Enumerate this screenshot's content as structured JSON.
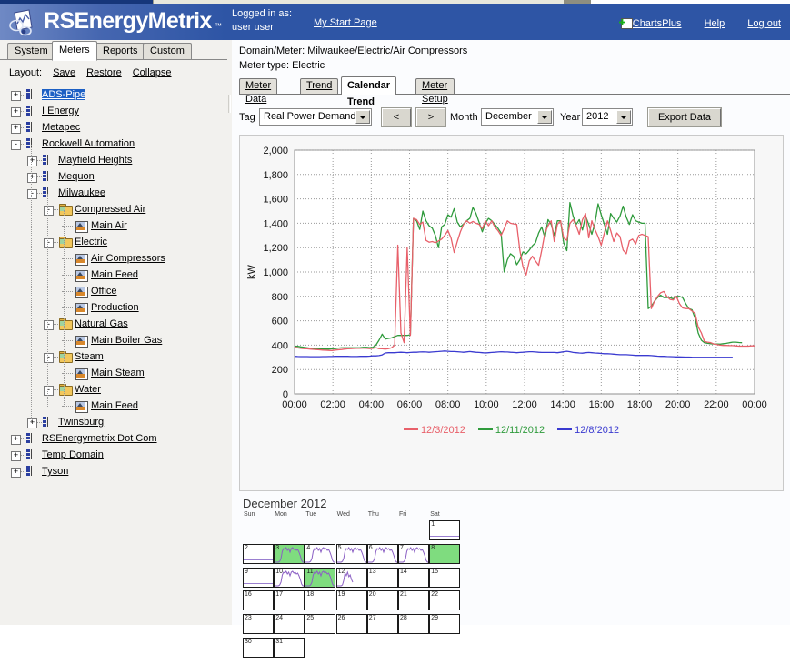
{
  "app": {
    "brand_rs": "RS",
    "brand_rest": "EnergyMetrix",
    "brand_tm": "™",
    "logged_in_label": "Logged in as:",
    "user": "user user",
    "my_start_page": "My Start Page",
    "header_color": "#2e55a5"
  },
  "header_links": [
    {
      "label": "ChartsPlus",
      "icon": "charts-plus-icon"
    },
    {
      "label": "Help",
      "icon": ""
    },
    {
      "label": "Log out",
      "icon": ""
    }
  ],
  "main_tabs": [
    {
      "label": "System",
      "active": false
    },
    {
      "label": "Meters",
      "active": true
    },
    {
      "label": "Reports",
      "active": false
    },
    {
      "label": "Custom",
      "active": false
    }
  ],
  "layout_bar": {
    "label": "Layout:",
    "actions": [
      "Save",
      "Restore",
      "Collapse"
    ]
  },
  "tree": [
    {
      "label": "ADS-Pipe",
      "depth": 0,
      "toggle": "+",
      "icon": "domain-icon",
      "selected": true
    },
    {
      "label": "I Energy",
      "depth": 0,
      "toggle": "+",
      "icon": "domain-icon",
      "selected": false
    },
    {
      "label": "Metapec",
      "depth": 0,
      "toggle": "+",
      "icon": "domain-icon",
      "selected": false
    },
    {
      "label": "Rockwell Automation",
      "depth": 0,
      "toggle": "-",
      "icon": "domain-icon",
      "selected": false
    },
    {
      "label": "Mayfield Heights",
      "depth": 1,
      "toggle": "+",
      "icon": "domain-icon",
      "selected": false
    },
    {
      "label": "Mequon",
      "depth": 1,
      "toggle": "+",
      "icon": "domain-icon",
      "selected": false
    },
    {
      "label": "Milwaukee",
      "depth": 1,
      "toggle": "-",
      "icon": "domain-icon",
      "selected": false
    },
    {
      "label": "Compressed Air",
      "depth": 2,
      "toggle": "-",
      "icon": "folder-icon",
      "selected": false
    },
    {
      "label": "Main Air",
      "depth": 3,
      "toggle": "",
      "icon": "meter-icon",
      "selected": false
    },
    {
      "label": "Electric",
      "depth": 2,
      "toggle": "-",
      "icon": "folder-icon",
      "selected": false
    },
    {
      "label": "Air Compressors",
      "depth": 3,
      "toggle": "",
      "icon": "meter-icon",
      "selected": false
    },
    {
      "label": "Main Feed",
      "depth": 3,
      "toggle": "",
      "icon": "meter-icon",
      "selected": false
    },
    {
      "label": "Office",
      "depth": 3,
      "toggle": "",
      "icon": "meter-icon",
      "selected": false
    },
    {
      "label": "Production",
      "depth": 3,
      "toggle": "",
      "icon": "meter-icon",
      "selected": false
    },
    {
      "label": "Natural Gas",
      "depth": 2,
      "toggle": "-",
      "icon": "folder-icon",
      "selected": false
    },
    {
      "label": "Main Boiler Gas",
      "depth": 3,
      "toggle": "",
      "icon": "meter-icon",
      "selected": false
    },
    {
      "label": "Steam",
      "depth": 2,
      "toggle": "-",
      "icon": "folder-icon",
      "selected": false
    },
    {
      "label": "Main Steam",
      "depth": 3,
      "toggle": "",
      "icon": "meter-icon",
      "selected": false
    },
    {
      "label": "Water",
      "depth": 2,
      "toggle": "-",
      "icon": "folder-icon",
      "selected": false
    },
    {
      "label": "Main Feed",
      "depth": 3,
      "toggle": "",
      "icon": "meter-icon",
      "selected": false
    },
    {
      "label": "Twinsburg",
      "depth": 1,
      "toggle": "+",
      "icon": "domain-icon",
      "selected": false
    },
    {
      "label": "RSEnergymetrix Dot Com",
      "depth": 0,
      "toggle": "+",
      "icon": "domain-icon",
      "selected": false
    },
    {
      "label": "Temp Domain",
      "depth": 0,
      "toggle": "+",
      "icon": "domain-icon",
      "selected": false
    },
    {
      "label": "Tyson",
      "depth": 0,
      "toggle": "+",
      "icon": "domain-icon",
      "selected": false
    }
  ],
  "breadcrumb": {
    "domain_meter": "Domain/Meter: Milwaukee/Electric/Air Compressors",
    "meter_type": "Meter type: Electric"
  },
  "sub_tabs": [
    {
      "label": "Meter Data",
      "active": false
    },
    {
      "label": "Trend",
      "active": false
    },
    {
      "label": "Calendar Trend",
      "active": true
    },
    {
      "label": "Meter Setup",
      "active": false
    }
  ],
  "toolbar": {
    "tag_label": "Tag",
    "tag_value": "Real Power Demand",
    "prev_label": "<",
    "next_label": ">",
    "month_label": "Month",
    "month_value": "December",
    "year_label": "Year",
    "year_value": "2012",
    "export_label": "Export Data"
  },
  "chart_data": {
    "type": "line",
    "title": "",
    "xlabel": "",
    "ylabel": "kW",
    "ylim": [
      0,
      2000
    ],
    "ytick_labels": [
      "0",
      "200",
      "400",
      "600",
      "800",
      "1,000",
      "1,200",
      "1,400",
      "1,600",
      "1,800",
      "2,000"
    ],
    "xtick_labels": [
      "00:00",
      "02:00",
      "04:00",
      "06:00",
      "08:00",
      "10:00",
      "12:00",
      "14:00",
      "16:00",
      "18:00",
      "20:00",
      "22:00",
      "00:00"
    ],
    "grid": true,
    "legend_position": "bottom",
    "series": [
      {
        "name": "12/3/2012",
        "color": "#e8606a",
        "values": [
          385,
          378,
          374,
          372,
          370,
          368,
          366,
          364,
          362,
          360,
          358,
          357,
          356,
          360,
          362,
          364,
          368,
          370,
          372,
          373,
          374,
          375,
          376,
          374,
          372,
          374,
          380,
          372,
          370,
          368,
          372,
          378,
          400,
          1220,
          500,
          420,
          1200,
          480,
          1440,
          1430,
          1390,
          1410,
          1260,
          1245,
          1250,
          1240,
          1255,
          1270,
          1300,
          1340,
          1280,
          1160,
          1250,
          1330,
          1390,
          1420,
          1400,
          1415,
          1400,
          1390,
          1355,
          1420,
          1380,
          1420,
          1370,
          1340,
          1300,
          1355,
          1420,
          1400,
          1395,
          1390,
          1180,
          1040,
          975,
          1090,
          1130,
          1090,
          1055,
          1180,
          1320,
          1380,
          1420,
          1250,
          1390,
          1420,
          1280,
          1260,
          1400,
          1430,
          1380,
          1310,
          1430,
          1480,
          1280,
          1420,
          1350,
          1290,
          1220,
          1320,
          1420,
          1340,
          1250,
          1320,
          1290,
          1180,
          1150,
          1255,
          1270,
          1230,
          1300,
          1310,
          1300,
          1290,
          700,
          760,
          800,
          830,
          840,
          800,
          775,
          770,
          800,
          740,
          705,
          700,
          700,
          680,
          660,
          550,
          500,
          430,
          425,
          420,
          410,
          405,
          400,
          398,
          398,
          396,
          396,
          394,
          392,
          392,
          392,
          392,
          394,
          394
        ]
      },
      {
        "name": "12/11/2012",
        "color": "#2f9b3c",
        "values": [
          392,
          390,
          386,
          382,
          378,
          375,
          373,
          371,
          370,
          368,
          368,
          368,
          370,
          372,
          376,
          378,
          378,
          378,
          378,
          378,
          378,
          380,
          382,
          382,
          380,
          382,
          400,
          440,
          490,
          450,
          455,
          460,
          470,
          480,
          480,
          480,
          480,
          485,
          1440,
          1420,
          1350,
          1500,
          1420,
          1380,
          1360,
          1300,
          1200,
          1370,
          1390,
          1470,
          1450,
          1520,
          1410,
          1370,
          1395,
          1420,
          1440,
          1530,
          1480,
          1405,
          1330,
          1400,
          1440,
          1420,
          1390,
          1360,
          1320,
          1000,
          1100,
          1150,
          1130,
          1060,
          1100,
          1165,
          1150,
          1180,
          1215,
          1240,
          1320,
          1370,
          1280,
          1430,
          1390,
          1300,
          1420,
          1420,
          1240,
          1175,
          1570,
          1460,
          1390,
          1430,
          1345,
          1460,
          1390,
          1310,
          1400,
          1560,
          1470,
          1390,
          1310,
          1480,
          1440,
          1410,
          1460,
          1540,
          1450,
          1390,
          1470,
          1420,
          1410,
          1400,
          1400,
          700,
          720,
          760,
          790,
          810,
          790,
          790,
          790,
          780,
          800,
          800,
          790,
          740,
          700,
          690,
          620,
          500,
          440,
          420,
          415,
          412,
          410,
          410,
          408,
          412,
          415,
          420,
          425,
          425,
          422,
          420
        ]
      },
      {
        "name": "12/8/2012",
        "color": "#3a3ad0",
        "values": [
          308,
          307,
          306,
          306,
          306,
          305,
          305,
          305,
          305,
          306,
          306,
          307,
          307,
          308,
          308,
          308,
          308,
          308,
          307,
          307,
          307,
          308,
          308,
          308,
          310,
          312,
          312,
          314,
          320,
          336,
          338,
          338,
          338,
          340,
          342,
          340,
          338,
          340,
          342,
          342,
          344,
          345,
          344,
          342,
          344,
          346,
          348,
          350,
          352,
          350,
          348,
          348,
          346,
          344,
          342,
          345,
          348,
          345,
          342,
          340,
          338,
          336,
          338,
          340,
          342,
          344,
          346,
          345,
          344,
          342,
          340,
          338,
          340,
          342,
          344,
          346,
          346,
          344,
          342,
          340,
          340,
          340,
          340,
          340,
          338,
          342,
          346,
          350,
          346,
          340,
          338,
          336,
          334,
          338,
          340,
          338,
          336,
          334,
          332,
          330,
          330,
          328,
          326,
          324,
          322,
          322,
          322,
          320,
          318,
          316,
          316,
          316,
          316,
          316,
          314,
          312,
          310,
          308,
          308,
          307,
          306,
          305,
          304,
          304,
          303,
          302,
          302,
          301,
          300,
          300,
          300,
          300,
          300,
          300,
          300,
          300,
          300,
          300,
          300,
          300,
          300
        ]
      }
    ]
  },
  "calendar": {
    "title": "December 2012",
    "dow": [
      "Sun",
      "Mon",
      "Tue",
      "Wed",
      "Thu",
      "Fri",
      "Sat"
    ],
    "weeks": [
      [
        null,
        null,
        null,
        null,
        null,
        null,
        {
          "day": "1",
          "highlight": false,
          "profile": "flat"
        }
      ],
      [
        {
          "day": "2",
          "highlight": false,
          "profile": "flat"
        },
        {
          "day": "3",
          "highlight": true,
          "profile": "load"
        },
        {
          "day": "4",
          "highlight": false,
          "profile": "load"
        },
        {
          "day": "5",
          "highlight": false,
          "profile": "load"
        },
        {
          "day": "6",
          "highlight": false,
          "profile": "load"
        },
        {
          "day": "7",
          "highlight": false,
          "profile": "load"
        },
        {
          "day": "8",
          "highlight": true,
          "profile": "none"
        }
      ],
      [
        {
          "day": "9",
          "highlight": false,
          "profile": "flat"
        },
        {
          "day": "10",
          "highlight": false,
          "profile": "load"
        },
        {
          "day": "11",
          "highlight": true,
          "profile": "load"
        },
        {
          "day": "12",
          "highlight": false,
          "profile": "partial"
        },
        {
          "day": "13",
          "highlight": false,
          "profile": "none"
        },
        {
          "day": "14",
          "highlight": false,
          "profile": "none"
        },
        {
          "day": "15",
          "highlight": false,
          "profile": "none"
        }
      ],
      [
        {
          "day": "16",
          "highlight": false,
          "profile": "none"
        },
        {
          "day": "17",
          "highlight": false,
          "profile": "none"
        },
        {
          "day": "18",
          "highlight": false,
          "profile": "none"
        },
        {
          "day": "19",
          "highlight": false,
          "profile": "none"
        },
        {
          "day": "20",
          "highlight": false,
          "profile": "none"
        },
        {
          "day": "21",
          "highlight": false,
          "profile": "none"
        },
        {
          "day": "22",
          "highlight": false,
          "profile": "none"
        }
      ],
      [
        {
          "day": "23",
          "highlight": false,
          "profile": "none"
        },
        {
          "day": "24",
          "highlight": false,
          "profile": "none"
        },
        {
          "day": "25",
          "highlight": false,
          "profile": "none"
        },
        {
          "day": "26",
          "highlight": false,
          "profile": "none"
        },
        {
          "day": "27",
          "highlight": false,
          "profile": "none"
        },
        {
          "day": "28",
          "highlight": false,
          "profile": "none"
        },
        {
          "day": "29",
          "highlight": false,
          "profile": "none"
        }
      ],
      [
        {
          "day": "30",
          "highlight": false,
          "profile": "none"
        },
        {
          "day": "31",
          "highlight": false,
          "profile": "none"
        },
        null,
        null,
        null,
        null,
        null
      ]
    ],
    "highlight_color": "#7fdc7f",
    "mini_line_color": "#8b5fc4"
  }
}
